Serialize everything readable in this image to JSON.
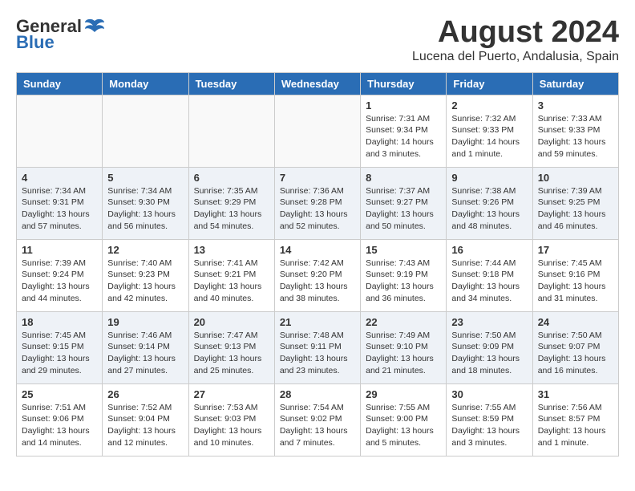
{
  "header": {
    "logo": {
      "general": "General",
      "blue": "Blue",
      "tagline": ""
    },
    "title": "August 2024",
    "location": "Lucena del Puerto, Andalusia, Spain"
  },
  "weekdays": [
    "Sunday",
    "Monday",
    "Tuesday",
    "Wednesday",
    "Thursday",
    "Friday",
    "Saturday"
  ],
  "weeks": [
    [
      {
        "day": "",
        "info": ""
      },
      {
        "day": "",
        "info": ""
      },
      {
        "day": "",
        "info": ""
      },
      {
        "day": "",
        "info": ""
      },
      {
        "day": "1",
        "info": "Sunrise: 7:31 AM\nSunset: 9:34 PM\nDaylight: 14 hours\nand 3 minutes."
      },
      {
        "day": "2",
        "info": "Sunrise: 7:32 AM\nSunset: 9:33 PM\nDaylight: 14 hours\nand 1 minute."
      },
      {
        "day": "3",
        "info": "Sunrise: 7:33 AM\nSunset: 9:33 PM\nDaylight: 13 hours\nand 59 minutes."
      }
    ],
    [
      {
        "day": "4",
        "info": "Sunrise: 7:34 AM\nSunset: 9:31 PM\nDaylight: 13 hours\nand 57 minutes."
      },
      {
        "day": "5",
        "info": "Sunrise: 7:34 AM\nSunset: 9:30 PM\nDaylight: 13 hours\nand 56 minutes."
      },
      {
        "day": "6",
        "info": "Sunrise: 7:35 AM\nSunset: 9:29 PM\nDaylight: 13 hours\nand 54 minutes."
      },
      {
        "day": "7",
        "info": "Sunrise: 7:36 AM\nSunset: 9:28 PM\nDaylight: 13 hours\nand 52 minutes."
      },
      {
        "day": "8",
        "info": "Sunrise: 7:37 AM\nSunset: 9:27 PM\nDaylight: 13 hours\nand 50 minutes."
      },
      {
        "day": "9",
        "info": "Sunrise: 7:38 AM\nSunset: 9:26 PM\nDaylight: 13 hours\nand 48 minutes."
      },
      {
        "day": "10",
        "info": "Sunrise: 7:39 AM\nSunset: 9:25 PM\nDaylight: 13 hours\nand 46 minutes."
      }
    ],
    [
      {
        "day": "11",
        "info": "Sunrise: 7:39 AM\nSunset: 9:24 PM\nDaylight: 13 hours\nand 44 minutes."
      },
      {
        "day": "12",
        "info": "Sunrise: 7:40 AM\nSunset: 9:23 PM\nDaylight: 13 hours\nand 42 minutes."
      },
      {
        "day": "13",
        "info": "Sunrise: 7:41 AM\nSunset: 9:21 PM\nDaylight: 13 hours\nand 40 minutes."
      },
      {
        "day": "14",
        "info": "Sunrise: 7:42 AM\nSunset: 9:20 PM\nDaylight: 13 hours\nand 38 minutes."
      },
      {
        "day": "15",
        "info": "Sunrise: 7:43 AM\nSunset: 9:19 PM\nDaylight: 13 hours\nand 36 minutes."
      },
      {
        "day": "16",
        "info": "Sunrise: 7:44 AM\nSunset: 9:18 PM\nDaylight: 13 hours\nand 34 minutes."
      },
      {
        "day": "17",
        "info": "Sunrise: 7:45 AM\nSunset: 9:16 PM\nDaylight: 13 hours\nand 31 minutes."
      }
    ],
    [
      {
        "day": "18",
        "info": "Sunrise: 7:45 AM\nSunset: 9:15 PM\nDaylight: 13 hours\nand 29 minutes."
      },
      {
        "day": "19",
        "info": "Sunrise: 7:46 AM\nSunset: 9:14 PM\nDaylight: 13 hours\nand 27 minutes."
      },
      {
        "day": "20",
        "info": "Sunrise: 7:47 AM\nSunset: 9:13 PM\nDaylight: 13 hours\nand 25 minutes."
      },
      {
        "day": "21",
        "info": "Sunrise: 7:48 AM\nSunset: 9:11 PM\nDaylight: 13 hours\nand 23 minutes."
      },
      {
        "day": "22",
        "info": "Sunrise: 7:49 AM\nSunset: 9:10 PM\nDaylight: 13 hours\nand 21 minutes."
      },
      {
        "day": "23",
        "info": "Sunrise: 7:50 AM\nSunset: 9:09 PM\nDaylight: 13 hours\nand 18 minutes."
      },
      {
        "day": "24",
        "info": "Sunrise: 7:50 AM\nSunset: 9:07 PM\nDaylight: 13 hours\nand 16 minutes."
      }
    ],
    [
      {
        "day": "25",
        "info": "Sunrise: 7:51 AM\nSunset: 9:06 PM\nDaylight: 13 hours\nand 14 minutes."
      },
      {
        "day": "26",
        "info": "Sunrise: 7:52 AM\nSunset: 9:04 PM\nDaylight: 13 hours\nand 12 minutes."
      },
      {
        "day": "27",
        "info": "Sunrise: 7:53 AM\nSunset: 9:03 PM\nDaylight: 13 hours\nand 10 minutes."
      },
      {
        "day": "28",
        "info": "Sunrise: 7:54 AM\nSunset: 9:02 PM\nDaylight: 13 hours\nand 7 minutes."
      },
      {
        "day": "29",
        "info": "Sunrise: 7:55 AM\nSunset: 9:00 PM\nDaylight: 13 hours\nand 5 minutes."
      },
      {
        "day": "30",
        "info": "Sunrise: 7:55 AM\nSunset: 8:59 PM\nDaylight: 13 hours\nand 3 minutes."
      },
      {
        "day": "31",
        "info": "Sunrise: 7:56 AM\nSunset: 8:57 PM\nDaylight: 13 hours\nand 1 minute."
      }
    ]
  ]
}
